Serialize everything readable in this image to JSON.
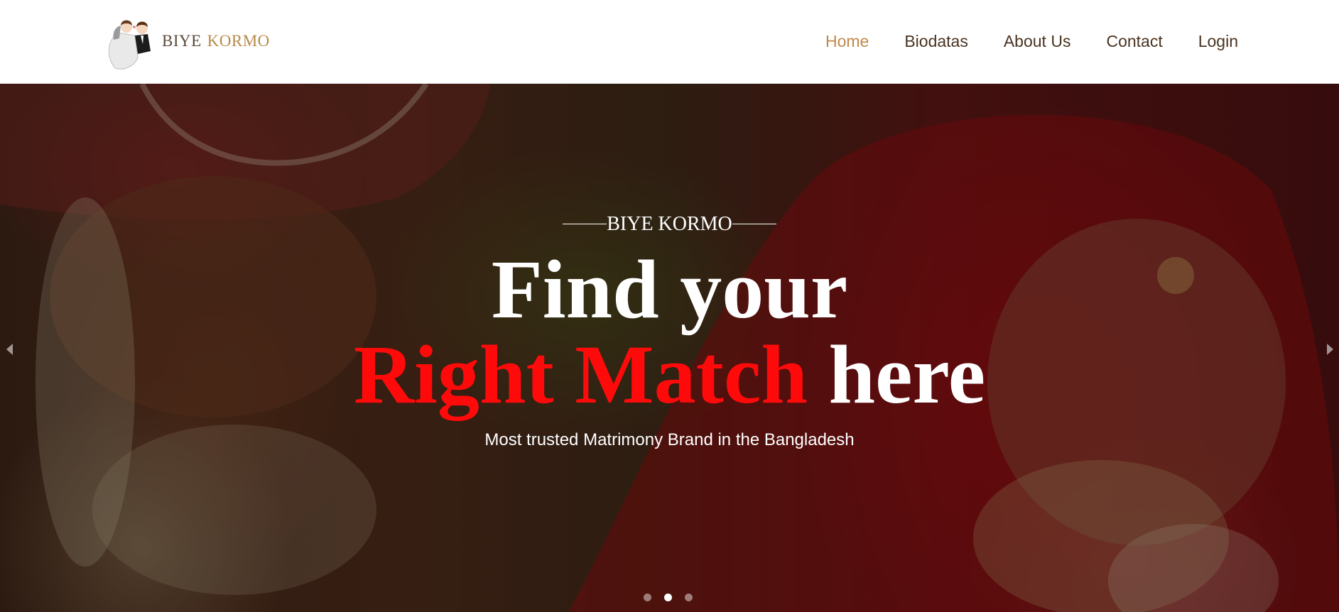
{
  "header": {
    "logo": {
      "word1": "BIYE",
      "word2": "KORMO"
    },
    "nav": [
      {
        "label": "Home",
        "active": true
      },
      {
        "label": "Biodatas",
        "active": false
      },
      {
        "label": "About Us",
        "active": false
      },
      {
        "label": "Contact",
        "active": false
      },
      {
        "label": "Login",
        "active": false
      }
    ]
  },
  "hero": {
    "eyebrow": "BIYE KORMO",
    "headline_line1": "Find your",
    "headline_highlight": "Right Match",
    "headline_rest": "here",
    "tagline": "Most trusted Matrimony Brand in the Bangladesh",
    "slides_total": 3,
    "active_slide": 2,
    "prev_icon": "chevron-left-icon",
    "next_icon": "chevron-right-icon"
  },
  "colors": {
    "nav_active": "#c0894a",
    "nav_text": "#4a3320",
    "highlight_red": "#ff0a0a",
    "logo_gold": "#b88a4a"
  }
}
